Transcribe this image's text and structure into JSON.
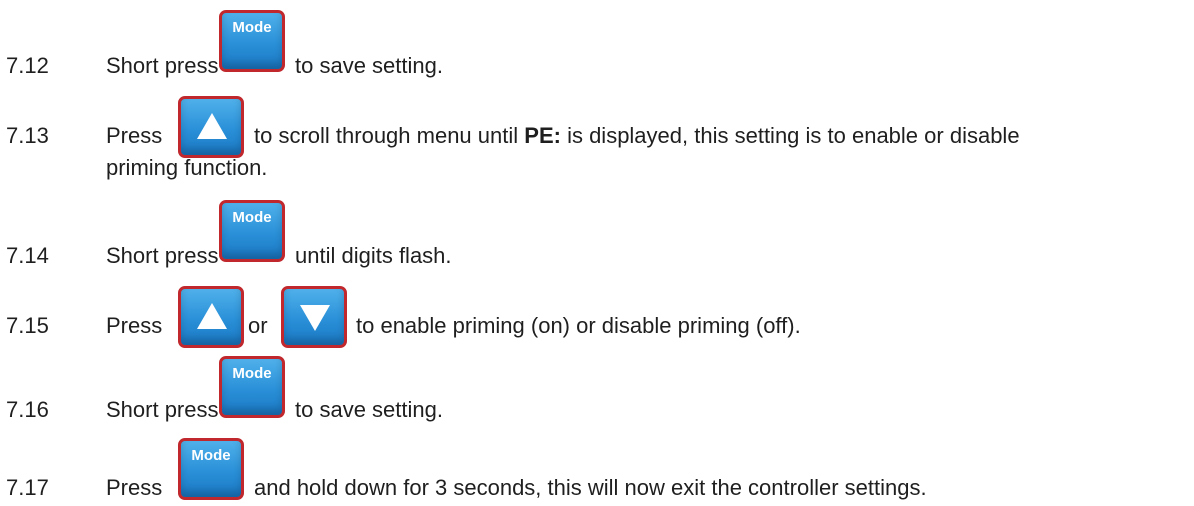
{
  "buttons": {
    "mode_label": "Mode"
  },
  "steps": [
    {
      "number": "7.12",
      "before": "Short press",
      "after": "to save setting."
    },
    {
      "number": "7.13",
      "before": "Press",
      "after_a": "to scroll through menu until ",
      "bold": "PE:",
      "after_b": " is displayed, this setting is to enable or disable",
      "line2": "priming function."
    },
    {
      "number": "7.14",
      "before": "Short press",
      "after": "until digits flash."
    },
    {
      "number": "7.15",
      "before": "Press",
      "middle": "or",
      "after": "to enable priming (on) or disable priming (off)."
    },
    {
      "number": "7.16",
      "before": "Short press",
      "after": "to save setting."
    },
    {
      "number": "7.17",
      "before": "Press",
      "after": "and hold down for 3 seconds, this will now exit the controller settings."
    }
  ],
  "icons": {
    "mode": "mode-button-icon",
    "up": "up-arrow-button-icon",
    "down": "down-arrow-button-icon"
  },
  "colors": {
    "button_fill": "#2a90d8",
    "button_border": "#c0282d",
    "text": "#1f1f1f"
  }
}
